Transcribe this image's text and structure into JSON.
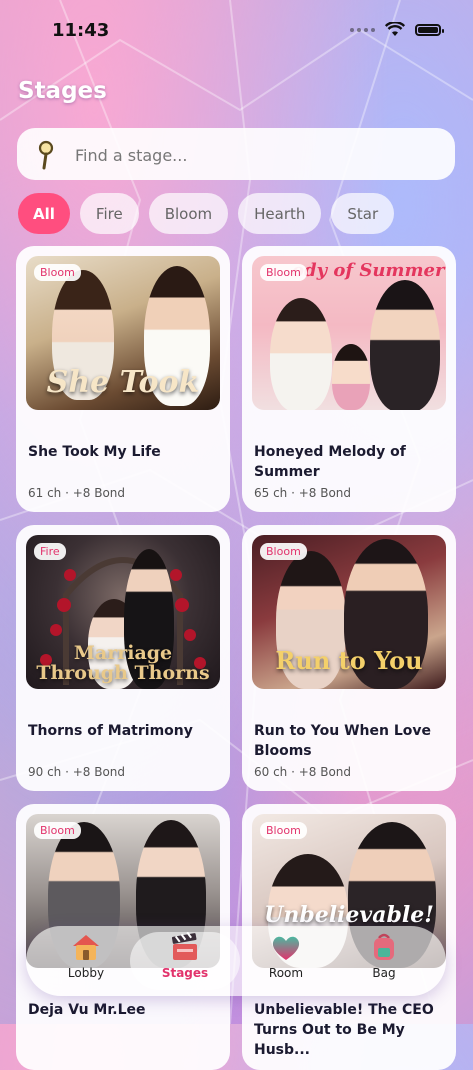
{
  "status": {
    "time": "11:43"
  },
  "page_title": "Stages",
  "search": {
    "placeholder": "Find a stage..."
  },
  "filters": [
    "All",
    "Fire",
    "Bloom",
    "Hearth",
    "Star"
  ],
  "active_filter": "All",
  "cards": [
    {
      "tag": "Bloom",
      "cover_text": "She Took",
      "title": "She Took My Life",
      "meta": "61 ch · +8 Bond"
    },
    {
      "tag": "Bloom",
      "cover_text": "ody of Summer",
      "title": "Honeyed Melody of Summer",
      "meta": "65 ch · +8 Bond"
    },
    {
      "tag": "Fire",
      "cover_text": "Marriage Through Thorns",
      "title": "Thorns of Matrimony",
      "meta": "90 ch · +8 Bond"
    },
    {
      "tag": "Bloom",
      "cover_text": "Run to You",
      "title": "Run to You When Love Blooms",
      "meta": "60 ch · +8 Bond"
    },
    {
      "tag": "Bloom",
      "cover_text": "",
      "title": "Deja Vu Mr.Lee",
      "meta": ""
    },
    {
      "tag": "Bloom",
      "cover_text": "Unbelievable!",
      "title": "Unbelievable! The CEO Turns Out to Be My Husb...",
      "meta": ""
    }
  ],
  "tabs": [
    {
      "label": "Lobby",
      "icon": "house-icon"
    },
    {
      "label": "Stages",
      "icon": "clapperboard-icon"
    },
    {
      "label": "Room",
      "icon": "heart-icon"
    },
    {
      "label": "Bag",
      "icon": "backpack-icon"
    }
  ],
  "active_tab": "Stages",
  "colors": {
    "accent": "#ff4e7f",
    "tag_text": "#e2336c"
  }
}
